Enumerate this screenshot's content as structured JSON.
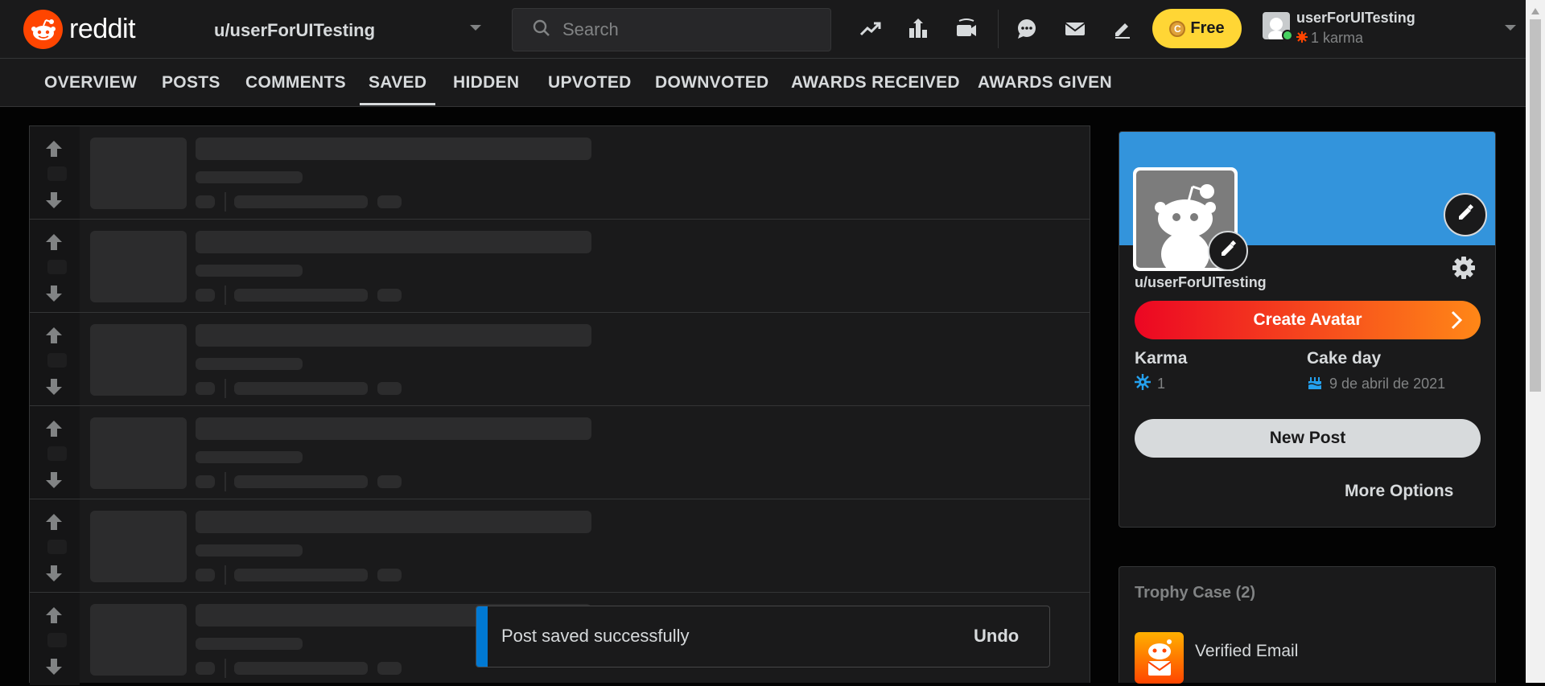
{
  "header": {
    "logo_text": "reddit",
    "user_switcher_label": "u/userForUITesting",
    "search_placeholder": "Search",
    "free_label": "Free",
    "username": "userForUITesting",
    "karma": "1 karma"
  },
  "tabs": [
    {
      "label": "OVERVIEW"
    },
    {
      "label": "POSTS"
    },
    {
      "label": "COMMENTS"
    },
    {
      "label": "SAVED",
      "active": true
    },
    {
      "label": "HIDDEN"
    },
    {
      "label": "UPVOTED"
    },
    {
      "label": "DOWNVOTED"
    },
    {
      "label": "AWARDS RECEIVED"
    },
    {
      "label": "AWARDS GIVEN"
    }
  ],
  "profile": {
    "name": "u/userForUITesting",
    "create_avatar_label": "Create Avatar",
    "karma_label": "Karma",
    "karma_value": "1",
    "cake_day_label": "Cake day",
    "cake_day_value": "9 de abril de 2021",
    "new_post_label": "New Post",
    "more_options_label": "More Options"
  },
  "trophy_case": {
    "title": "Trophy Case (2)",
    "items": [
      {
        "name": "Verified Email"
      }
    ]
  },
  "toast": {
    "message": "Post saved successfully",
    "undo_label": "Undo"
  },
  "colors": {
    "accent": "#FF4500",
    "banner": "#3394DC",
    "free_button": "#FFD635",
    "toast_bar": "#0079D3"
  }
}
